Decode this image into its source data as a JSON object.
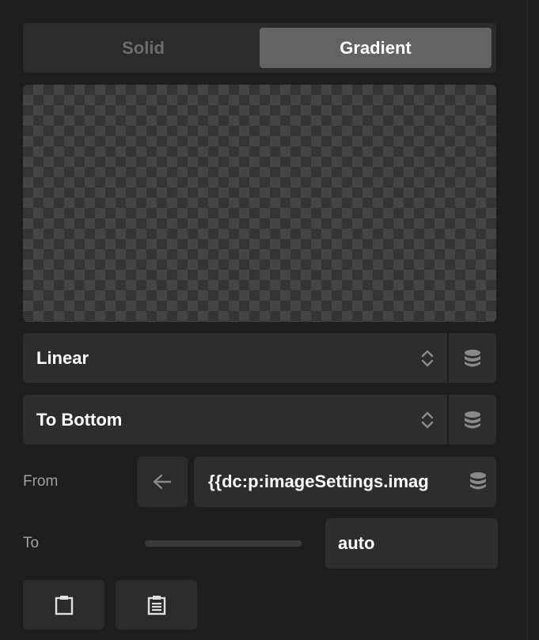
{
  "fill_type_tabs": {
    "solid": "Solid",
    "gradient": "Gradient",
    "active": "Gradient"
  },
  "gradient_type": {
    "value": "Linear"
  },
  "direction": {
    "value": "To Bottom"
  },
  "from": {
    "label": "From",
    "value": "{{dc:p:imageSettings.imag"
  },
  "to": {
    "label": "To",
    "value": "auto"
  },
  "icons": {
    "chevron": "chevron-up-down-icon",
    "dynamic_data": "database-icon",
    "arrow": "arrow-left-icon",
    "copy": "clipboard-icon",
    "paste": "clipboard-list-icon"
  },
  "colors": {
    "background": "#1e1e1e",
    "panel": "#2d2d2d",
    "active_tab": "#636363",
    "icon": "#8a8a8a"
  }
}
